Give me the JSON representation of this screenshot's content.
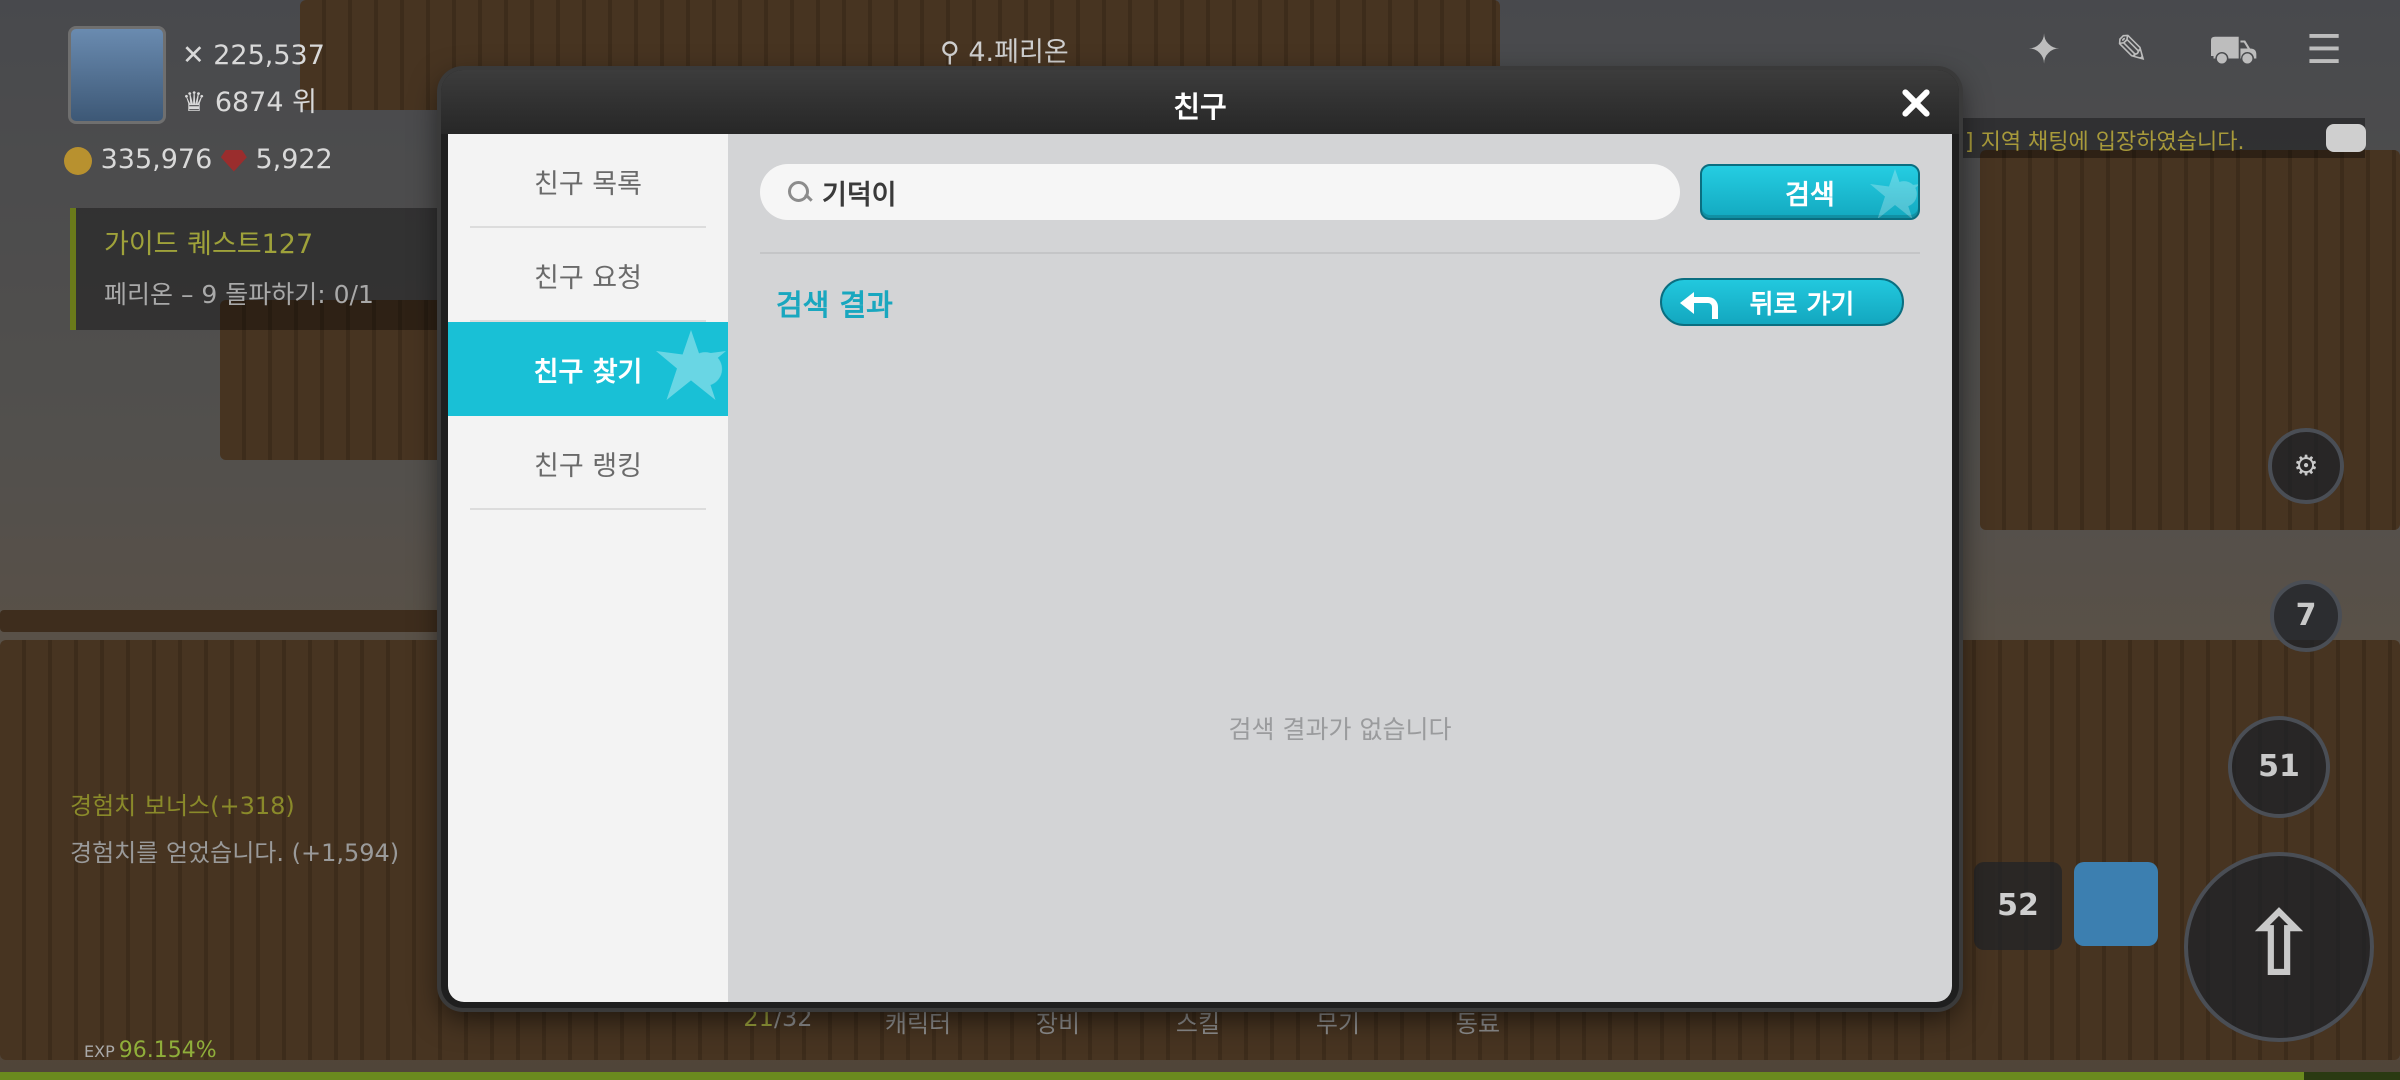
{
  "hud": {
    "power": "225,537",
    "rank": "6874 위",
    "meso": "335,976",
    "gems": "5,922",
    "location": "4.페리온",
    "quest_title": "가이드 퀘스트127",
    "quest_desc": "페리온 – 9 돌파하기: 0/1",
    "chat_notice": "] 지역 채팅에 입장하였습니다.",
    "exp_log_1": "경험치 보너스(+318)",
    "exp_log_2": "경험치를 얻었습니다. (+1,594)",
    "bottom_tabs": {
      "count_now": "21",
      "count_total": "/32",
      "character": "캐릭터",
      "equipment": "장비",
      "skill": "스킬",
      "weapon": "무기",
      "companion": "동료"
    },
    "exp_label": "EXP",
    "exp_value": "96.154%",
    "badge_7": "7",
    "badge_51": "51",
    "badge_52": "52"
  },
  "modal": {
    "title": "친구",
    "sidebar": {
      "items": [
        {
          "label": "친구 목록"
        },
        {
          "label": "친구 요청"
        },
        {
          "label": "친구 찾기"
        },
        {
          "label": "친구 랭킹"
        }
      ]
    },
    "search": {
      "value": "기덕이",
      "button_label": "검색"
    },
    "results": {
      "title": "검색 결과",
      "back_label": "뒤로 가기",
      "empty_message": "검색 결과가 없습니다"
    }
  },
  "colors": {
    "accent": "#19c0d6",
    "accent_text": "#19a7bf",
    "sidebar_bg": "#f3f3f3",
    "content_bg": "#d3d4d6"
  }
}
